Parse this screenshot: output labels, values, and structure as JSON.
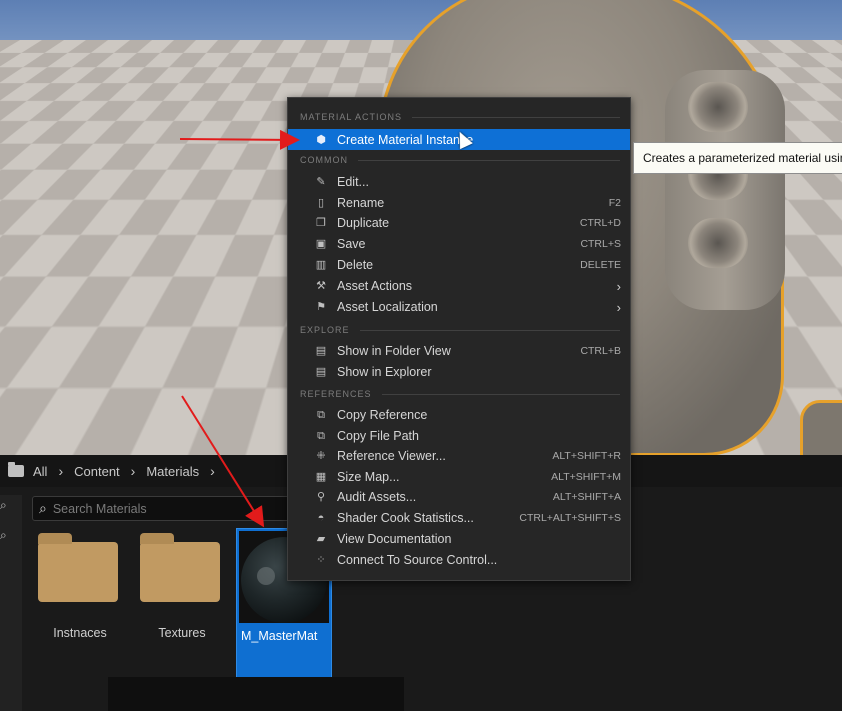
{
  "menu": {
    "sections": {
      "material_actions": "MATERIAL ACTIONS",
      "common": "COMMON",
      "explore": "EXPLORE",
      "references": "REFERENCES"
    },
    "items": {
      "create_material_instance": {
        "label": "Create Material Instance",
        "icon": "material-instance-icon"
      },
      "edit": {
        "label": "Edit...",
        "icon": "pencil-icon"
      },
      "rename": {
        "label": "Rename",
        "shortcut": "F2",
        "icon": "rename-icon"
      },
      "duplicate": {
        "label": "Duplicate",
        "shortcut": "CTRL+D",
        "icon": "duplicate-icon"
      },
      "save": {
        "label": "Save",
        "shortcut": "CTRL+S",
        "icon": "save-icon"
      },
      "delete": {
        "label": "Delete",
        "shortcut": "DELETE",
        "icon": "trash-icon"
      },
      "asset_actions": {
        "label": "Asset Actions",
        "icon": "wrench-icon"
      },
      "asset_localization": {
        "label": "Asset Localization",
        "icon": "flag-icon"
      },
      "show_in_folder_view": {
        "label": "Show in Folder View",
        "shortcut": "CTRL+B",
        "icon": "folder-view-icon"
      },
      "show_in_explorer": {
        "label": "Show in Explorer",
        "icon": "explorer-icon"
      },
      "copy_reference": {
        "label": "Copy Reference",
        "icon": "copy-icon"
      },
      "copy_file_path": {
        "label": "Copy File Path",
        "icon": "copy-path-icon"
      },
      "reference_viewer": {
        "label": "Reference Viewer...",
        "shortcut": "ALT+SHIFT+R",
        "icon": "reference-viewer-icon"
      },
      "size_map": {
        "label": "Size Map...",
        "shortcut": "ALT+SHIFT+M",
        "icon": "size-map-icon"
      },
      "audit_assets": {
        "label": "Audit Assets...",
        "shortcut": "ALT+SHIFT+A",
        "icon": "audit-icon"
      },
      "shader_cook_statistics": {
        "label": "Shader Cook Statistics...",
        "shortcut": "CTRL+ALT+SHIFT+S",
        "icon": "shader-icon"
      },
      "view_documentation": {
        "label": "View Documentation",
        "icon": "documentation-icon"
      },
      "connect_to_source_control": {
        "label": "Connect To Source Control...",
        "icon": "source-control-icon"
      }
    }
  },
  "tooltip": {
    "text": "Creates a parameterized material using this material as a base."
  },
  "breadcrumb": {
    "items": [
      "All",
      "Content",
      "Materials"
    ]
  },
  "search": {
    "placeholder": "Search Materials"
  },
  "assets": [
    {
      "label": "Instnaces",
      "type": "folder"
    },
    {
      "label": "Textures",
      "type": "folder"
    },
    {
      "label": "M_MasterMat",
      "type": "material"
    }
  ],
  "colors": {
    "highlight": "#0e70d6",
    "annotation_arrow": "#e21b1b"
  }
}
